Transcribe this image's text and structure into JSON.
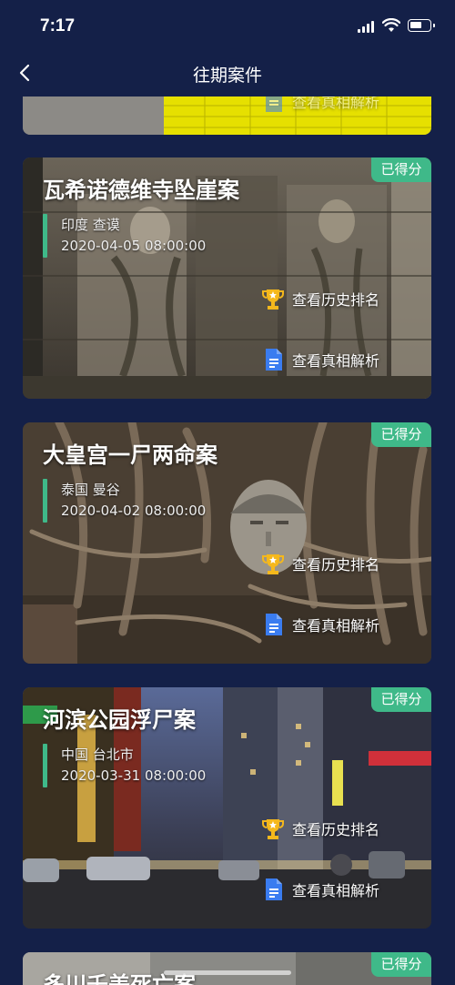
{
  "status": {
    "time": "7:17"
  },
  "nav": {
    "title": "往期案件",
    "back_icon": "chevron-left-icon"
  },
  "top_peek": {
    "action_label": "查看真相解析"
  },
  "cases": [
    {
      "title": "瓦希诺德维寺坠崖案",
      "location": "印度 查谟",
      "date": "2020-04-05 08:00:00",
      "badge": "已得分",
      "rank_label": "查看历史排名",
      "analysis_label": "查看真相解析",
      "theme": "stone-temple"
    },
    {
      "title": "大皇宫一尸两命案",
      "location": "泰国 曼谷",
      "date": "2020-04-02 08:00:00",
      "badge": "已得分",
      "rank_label": "查看历史排名",
      "analysis_label": "查看真相解析",
      "theme": "buddha-tree-roots"
    },
    {
      "title": "河滨公园浮尸案",
      "location": "中国 台北市",
      "date": "2020-03-31 08:00:00",
      "badge": "已得分",
      "rank_label": "查看历史排名",
      "analysis_label": "查看真相解析",
      "theme": "city-night-street"
    }
  ],
  "bottom_peek": {
    "title": "多川千美死亡案",
    "badge": "已得分"
  },
  "colors": {
    "background": "#142048",
    "accent_green": "#3fb989",
    "trophy": "#f5b81c",
    "doc_blue": "#3a7cf0"
  }
}
